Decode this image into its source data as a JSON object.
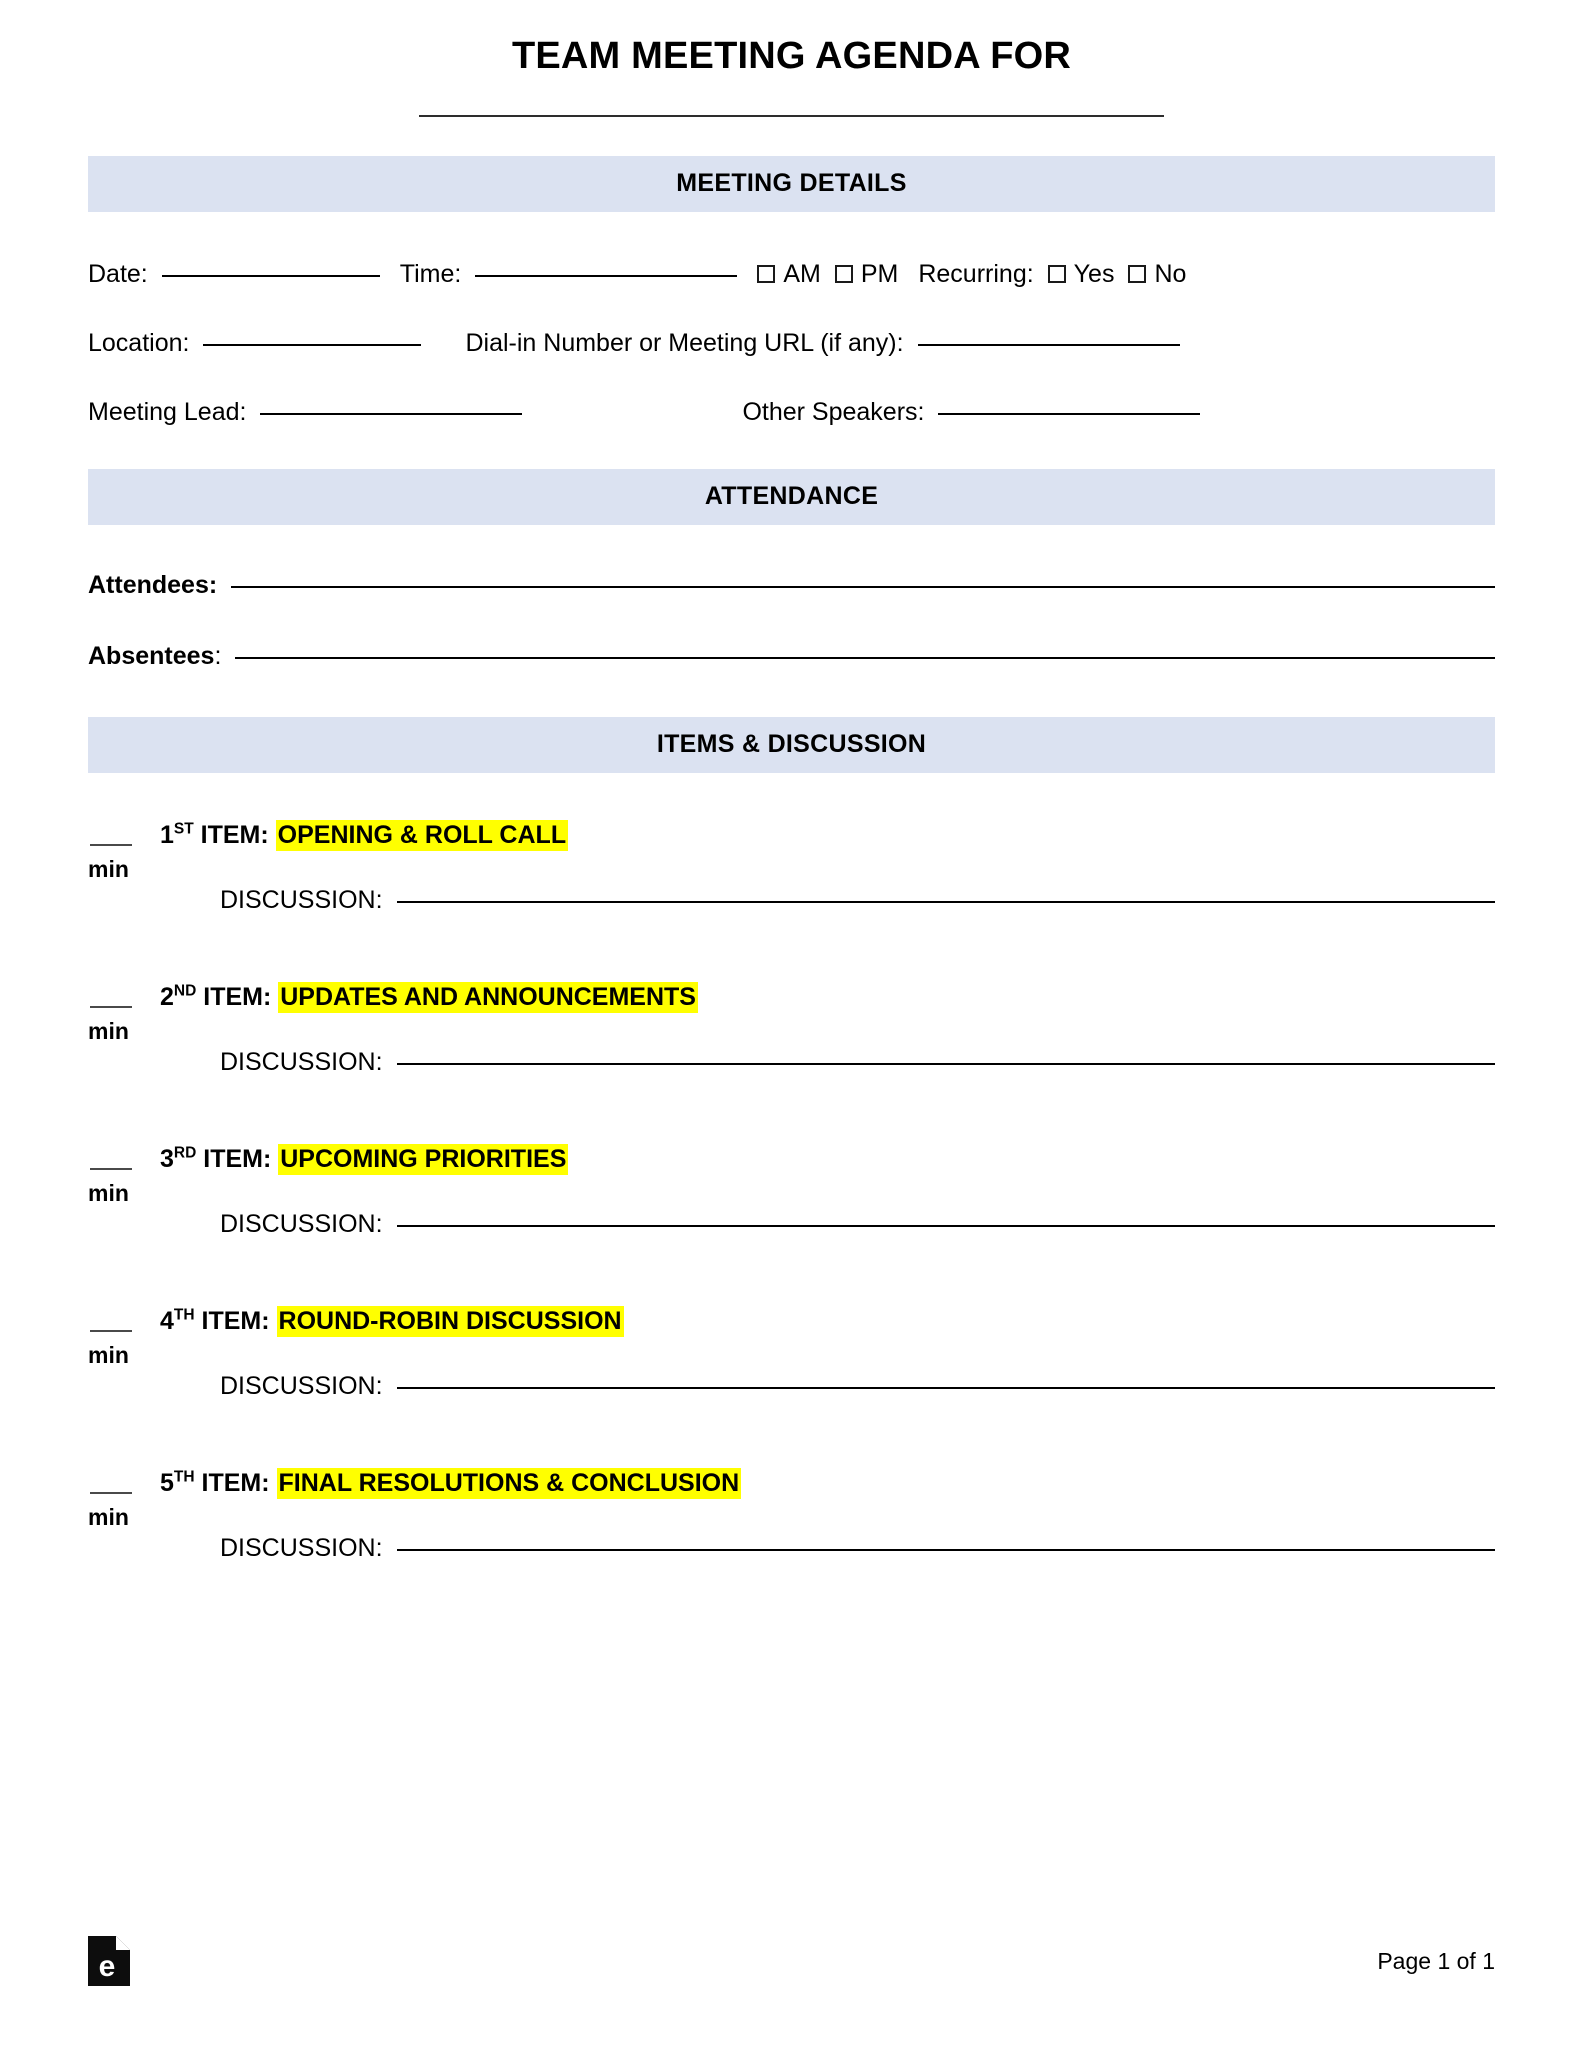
{
  "document": {
    "title": "TEAM MEETING AGENDA FOR",
    "title_blank_label": "____________________________________________"
  },
  "sections": {
    "meeting_details": {
      "heading": "MEETING DETAILS",
      "date_label": "Date:",
      "time_label": "Time:",
      "am_label": "AM",
      "pm_label": "PM",
      "recurring_label": "Recurring:",
      "yes_label": "Yes",
      "no_label": "No",
      "location_label": "Location:",
      "dialin_label": "Dial-in Number or Meeting URL (if any):",
      "meeting_lead_label": "Meeting Lead:",
      "other_speakers_label": "Other Speakers:"
    },
    "attendance": {
      "heading": "ATTENDANCE",
      "attendees_label": "Attendees:",
      "absentees_label": "Absentees",
      "absentees_colon": ":"
    },
    "items_discussion": {
      "heading": "ITEMS & DISCUSSION",
      "min_label": "min",
      "discussion_label": "DISCUSSION:",
      "items": [
        {
          "ordinal_number": "1",
          "ordinal_suffix": "ST",
          "item_word": " ITEM: ",
          "title": "OPENING & ROLL CALL"
        },
        {
          "ordinal_number": "2",
          "ordinal_suffix": "ND",
          "item_word": " ITEM: ",
          "title": "UPDATES AND ANNOUNCEMENTS"
        },
        {
          "ordinal_number": "3",
          "ordinal_suffix": "RD",
          "item_word": " ITEM: ",
          "title": "UPCOMING PRIORITIES"
        },
        {
          "ordinal_number": "4",
          "ordinal_suffix": "TH",
          "item_word": " ITEM: ",
          "title": "ROUND-ROBIN DISCUSSION"
        },
        {
          "ordinal_number": "5",
          "ordinal_suffix": "TH",
          "item_word": " ITEM: ",
          "title": "FINAL RESOLUTIONS & CONCLUSION"
        }
      ]
    }
  },
  "footer": {
    "logo_letter": "e",
    "page_number": "Page 1 of 1"
  },
  "colors": {
    "section_bar": "#dbe2f1",
    "highlight": "#ffff00",
    "text": "#000000"
  }
}
